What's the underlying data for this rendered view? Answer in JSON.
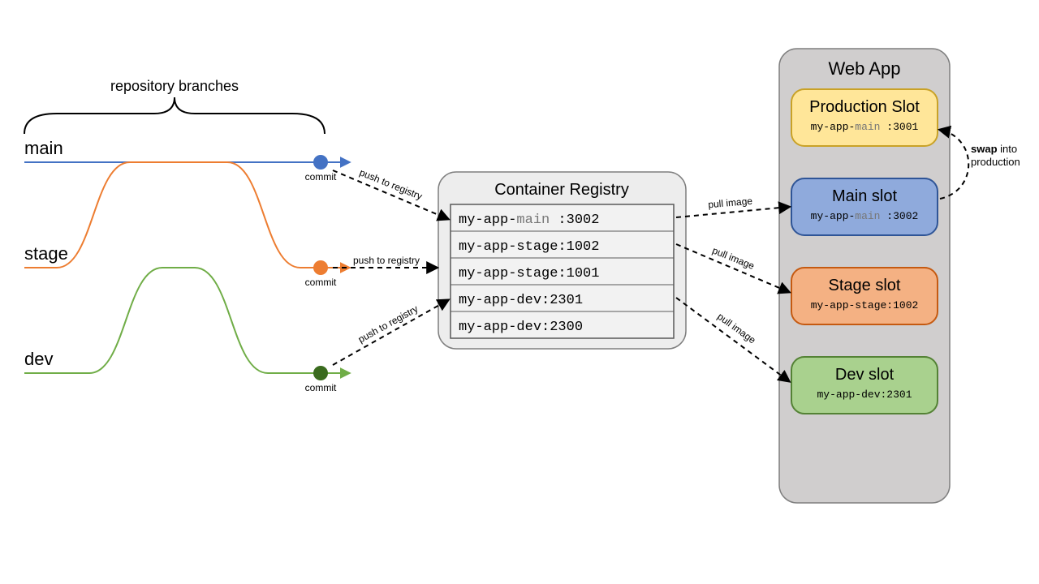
{
  "bracket_label": "repository branches",
  "branches": {
    "main": "main",
    "stage": "stage",
    "dev": "dev"
  },
  "commit_label": "commit",
  "push_label": "push to registry",
  "pull_label": "pull image",
  "registry": {
    "title": "Container Registry",
    "row1_prefix": "my-app-",
    "row1_branch": "main",
    "row1_suffix": " :3002",
    "row2": "my-app-stage:1002",
    "row3": "my-app-stage:1001",
    "row4": "my-app-dev:2301",
    "row5": "my-app-dev:2300"
  },
  "webapp": {
    "title": "Web App",
    "prod": {
      "title": "Production Slot",
      "tag_prefix": "my-app-",
      "tag_branch": "main",
      "tag_suffix": " :3001"
    },
    "main": {
      "title": "Main slot",
      "tag_prefix": "my-app-",
      "tag_branch": "main",
      "tag_suffix": " :3002"
    },
    "stage": {
      "title": "Stage slot",
      "tag": "my-app-stage:1002"
    },
    "dev": {
      "title": "Dev slot",
      "tag": "my-app-dev:2301"
    }
  },
  "swap": {
    "bold": "swap",
    "rest": " into\nproduction"
  },
  "colors": {
    "blue": "#4472C4",
    "orange": "#ED7D31",
    "green": "#70AD47",
    "yellow_fill": "#FFE699",
    "yellow_stroke": "#C9A227",
    "blue_fill": "#8FAADC",
    "blue_stroke": "#2F5597",
    "orange_fill": "#F4B183",
    "orange_stroke": "#C55A11",
    "green_fill": "#A9D18E",
    "green_stroke": "#548235",
    "grey_fill": "#EDEDED",
    "grey_stroke": "#7F7F7F",
    "webapp_fill": "#D0CECE",
    "webapp_stroke": "#7F7F7F"
  }
}
